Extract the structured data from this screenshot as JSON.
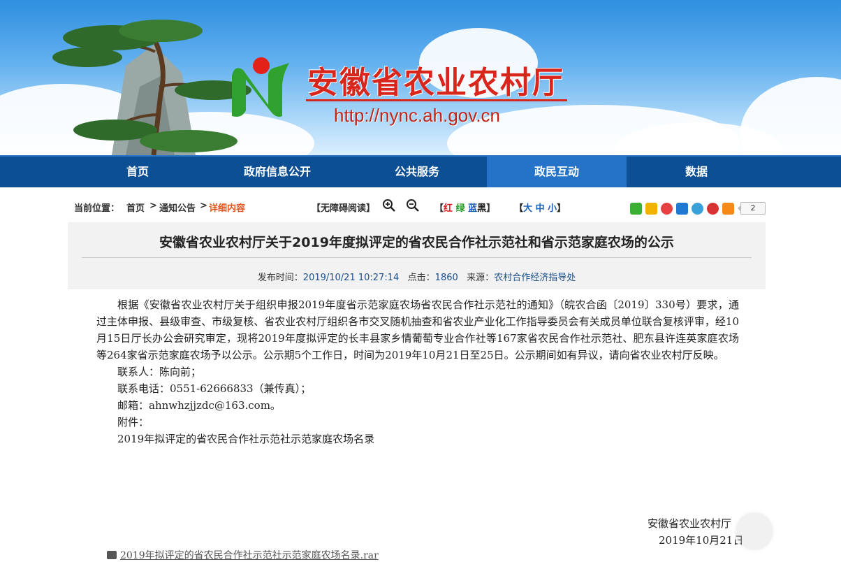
{
  "site": {
    "title": "安徽省农业农村厅",
    "url": "http://nync.ah.gov.cn",
    "colors": {
      "brand_red": "#d9261c",
      "nav_blue": "#0d4f94",
      "nav_active": "#2473c9"
    }
  },
  "nav": {
    "items": [
      {
        "label": "首页",
        "active": false
      },
      {
        "label": "政府信息公开",
        "active": false
      },
      {
        "label": "公共服务",
        "active": false
      },
      {
        "label": "政民互动",
        "active": true
      },
      {
        "label": "数据",
        "active": false
      }
    ]
  },
  "breadcrumb": {
    "label": "当前位置：",
    "items": [
      "首页",
      "通知公告",
      "详细内容"
    ],
    "sep": ">"
  },
  "toolbar": {
    "accessible": "【无障碍阅读】",
    "zoom_in_icon": "zoom-in-icon",
    "zoom_out_icon": "zoom-out-icon",
    "color_open": "【",
    "color_red": "红",
    "color_green": "绿",
    "color_blue": "蓝",
    "color_black": "黑",
    "color_close": "】",
    "font_open": "【",
    "font_large": "大",
    "font_medium": "中",
    "font_small": "小",
    "font_close": "】"
  },
  "share": {
    "icons": [
      "wechat-icon",
      "qzone-icon",
      "weibo-icon",
      "renren-icon",
      "tencent-weibo-icon",
      "qq-icon",
      "more-share-icon"
    ],
    "count": "2"
  },
  "article": {
    "title": "安徽省农业农村厅关于2019年度拟评定的省农民合作社示范社和省示范家庭农场的公示",
    "meta": {
      "time_label": "发布时间：",
      "time": "2019/10/21 10:27:14",
      "clicks_label": "点击：",
      "clicks": "1860",
      "source_label": "来源：",
      "source": "农村合作经济指导处"
    },
    "paragraph": "根据《安徽省农业农村厅关于组织申报2019年度省示范家庭农场省农民合作社示范社的通知》（皖农合函〔2019〕330号）要求，通过主体申报、县级审查、市级复核、省农业农村厅组织各市交叉随机抽查和省农业产业化工作指导委员会有关成员单位联合复核评审，经10月15日厅长办公会研究审定，现将2019年度拟评定的长丰县家乡情葡萄专业合作社等167家省农民合作社示范社、肥东县许连英家庭农场等264家省示范家庭农场予以公示。公示期5个工作日，时间为2019年10月21日至25日。公示期间如有异议，请向省农业农村厅反映。",
    "contact": "联系人：陈向前；",
    "phone": "联系电话：0551-62666833（兼传真）；",
    "email": "邮箱：ahnwhzjjzdc@163.com。",
    "attachment_label": "附件：",
    "attachment_name": "2019年拟评定的省农民合作社示范社示范家庭农场名录",
    "signature": "安徽省农业农村厅",
    "date": "2019年10月21日",
    "attachment_link": "2019年拟评定的省农民合作社示范社示范家庭农场名录.rar"
  }
}
